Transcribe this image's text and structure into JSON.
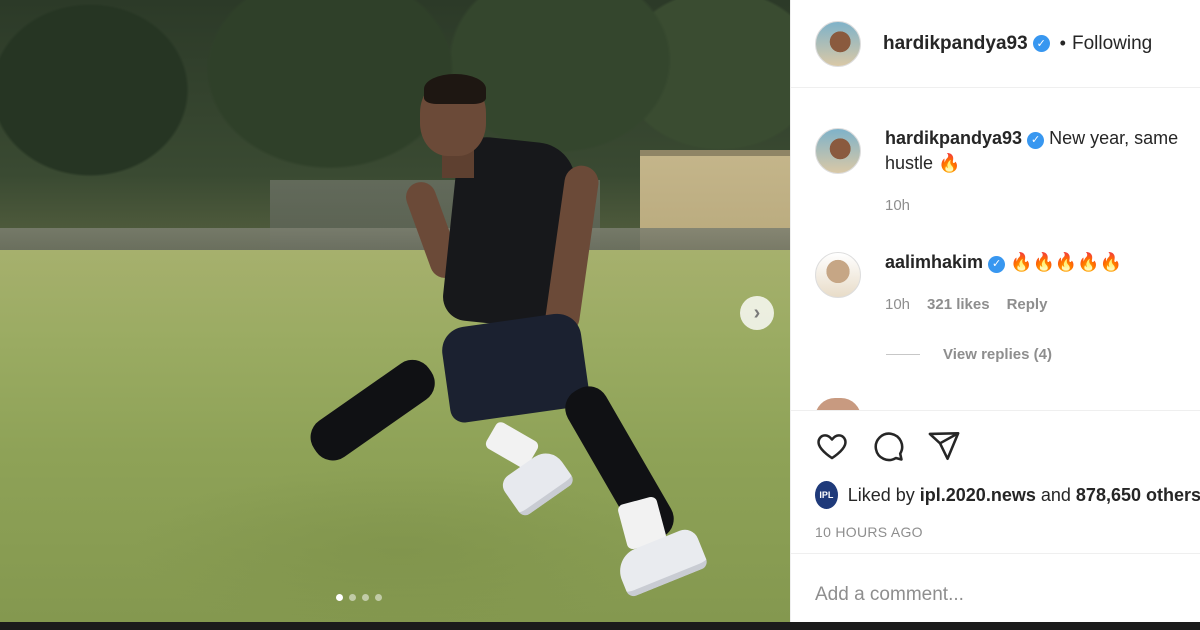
{
  "post": {
    "author": "hardikpandya93",
    "follow_sep": "•",
    "follow_status": "Following"
  },
  "caption": {
    "username": "hardikpandya93",
    "text": "New year, same hustle 🔥",
    "time": "10h"
  },
  "comments": [
    {
      "username": "aalimhakim",
      "text": "🔥🔥🔥🔥🔥",
      "time": "10h",
      "likes": "321 likes",
      "reply_label": "Reply",
      "view_replies": "View replies (4)"
    }
  ],
  "media": {
    "slide_count": 4,
    "active_slide": 1,
    "next_symbol": "›"
  },
  "engagement": {
    "liked_by_prefix": "Liked by",
    "liked_by_user": "ipl.2020.news",
    "liked_by_connector": "and",
    "liked_by_others": "878,650 others",
    "liker_avatar_text": "IPL",
    "posted_ago": "10 HOURS AGO"
  },
  "composer": {
    "placeholder": "Add a comment..."
  },
  "colors": {
    "verified": "#3897f0",
    "muted": "#8e8e8e",
    "text": "#262626"
  }
}
